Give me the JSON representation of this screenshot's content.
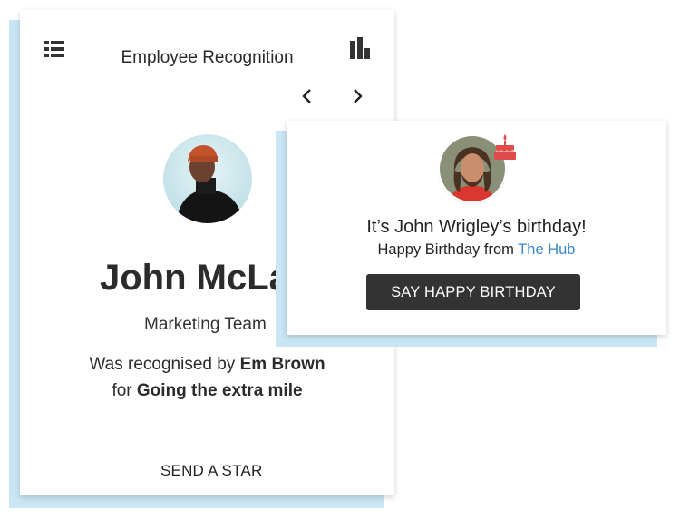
{
  "recognition": {
    "title": "Employee Recognition",
    "list_icon": "list-icon",
    "chart_icon": "bar-chart-icon",
    "prev_icon": "chevron-left-icon",
    "next_icon": "chevron-right-icon",
    "employee_name": "John McLa",
    "team": "Marketing Team",
    "recognised_prefix": "Was recognised by",
    "recognised_by": "Em Brown",
    "for_prefix": "for",
    "reason": "Going the extra mile",
    "send_button": "SEND A STAR"
  },
  "birthday": {
    "cake_icon": "birthday-cake-icon",
    "title": "It’s John Wrigley’s birthday!",
    "from_prefix": "Happy Birthday from",
    "from_link": "The Hub",
    "button": "SAY HAPPY BIRTHDAY"
  },
  "colors": {
    "accent_blue": "#3a87c8",
    "shadow_blue": "#c9e6f5",
    "cake_red": "#e04b4b",
    "button_dark": "#333333"
  }
}
